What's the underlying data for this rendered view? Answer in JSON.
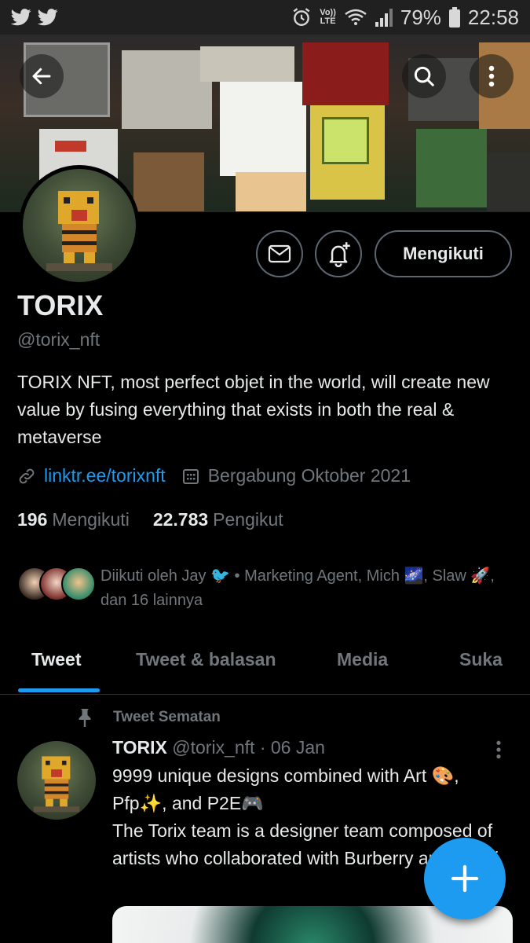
{
  "status_bar": {
    "lte_top": "Vo))",
    "lte_bottom": "LTE",
    "battery": "79%",
    "time": "22:58"
  },
  "profile": {
    "name": "TORIX",
    "handle": "@torix_nft",
    "bio": "TORIX NFT, most perfect objet in the world, will create new value by fusing everything that exists in both the real & metaverse",
    "link": "linktr.ee/torixnft",
    "joined": "Bergabung Oktober 2021",
    "following_count": "196",
    "following_label": "Mengikuti",
    "followers_count": "22.783",
    "followers_label": "Pengikut",
    "follow_button": "Mengikuti",
    "followed_by": "Diikuti oleh Jay 🐦 • Marketing Agent, Mich 🌌, Slaw 🚀, dan 16 lainnya"
  },
  "tabs": [
    {
      "label": "Tweet"
    },
    {
      "label": "Tweet & balasan"
    },
    {
      "label": "Media"
    },
    {
      "label": "Suka"
    }
  ],
  "pinned_tweet": {
    "pinned_label": "Tweet Sematan",
    "author": "TORIX",
    "meta": "@torix_nft · 06 Jan",
    "text": "9999 unique designs combined with Art 🎨, Pfp✨, and P2E🎮\nThe Torix team is a designer team composed of artists who collaborated with Burberry and Pepsi."
  },
  "colors": {
    "accent": "#1d9bf0",
    "background": "#000000",
    "secondary_text": "#71767b"
  }
}
